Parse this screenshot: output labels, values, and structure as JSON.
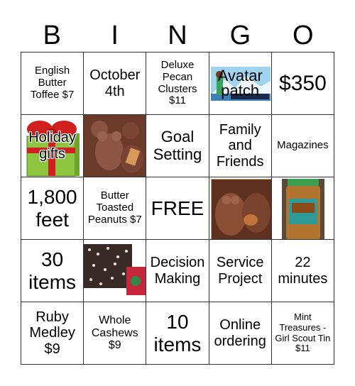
{
  "header": [
    "B",
    "I",
    "N",
    "G",
    "O"
  ],
  "cells": [
    {
      "text": "English Butter Toffee $7"
    },
    {
      "text": "October 4th"
    },
    {
      "text": "Deluxe Pecan Clusters $11"
    },
    {
      "text": "Avatar patch",
      "image": "avatar-patch-image"
    },
    {
      "text": "$350"
    },
    {
      "text": "Holiday gifts",
      "image": "gift-box-image"
    },
    {
      "text": "",
      "image": "chocolate-bears-image"
    },
    {
      "text": "Goal Setting"
    },
    {
      "text": "Family and Friends"
    },
    {
      "text": "Magazines"
    },
    {
      "text": "1,800 feet"
    },
    {
      "text": "Butter Toasted Peanuts $7"
    },
    {
      "text": "FREE"
    },
    {
      "text": "",
      "image": "chocolate-owls-image"
    },
    {
      "text": "",
      "image": "nut-jar-image"
    },
    {
      "text": "30 items"
    },
    {
      "text": "",
      "image": "peppermint-pretzels-image"
    },
    {
      "text": "Decision Making"
    },
    {
      "text": "Service Project"
    },
    {
      "text": "22 minutes"
    },
    {
      "text": "Ruby Medley $9"
    },
    {
      "text": "Whole Cashews $9"
    },
    {
      "text": "10 items"
    },
    {
      "text": "Online ordering"
    },
    {
      "text": "Mint Treasures - Girl Scout Tin $11"
    }
  ]
}
